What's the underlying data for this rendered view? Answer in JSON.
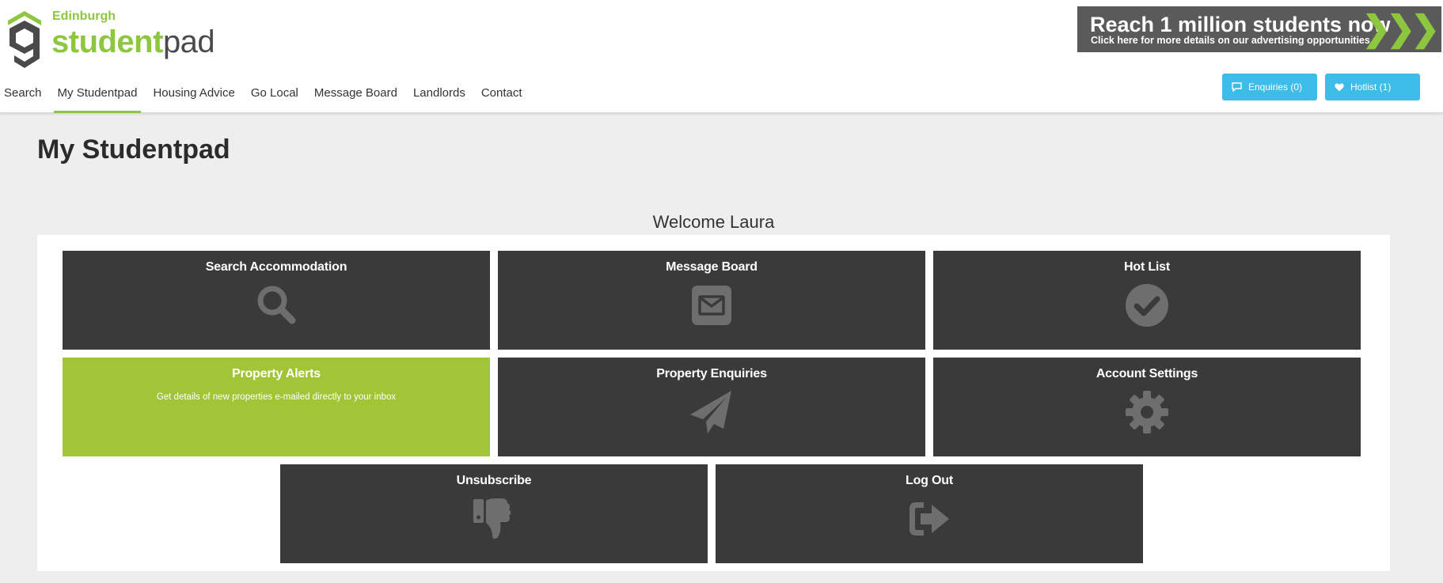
{
  "logo": {
    "city": "Edinburgh",
    "brand_part1": "student",
    "brand_part2": "pad"
  },
  "ad": {
    "headline": "Reach 1 million students now",
    "subline": "Click here for more details on our advertising opportunities",
    "arrows": "❯❯❯"
  },
  "nav": {
    "items": [
      {
        "label": "Search"
      },
      {
        "label": "My Studentpad"
      },
      {
        "label": "Housing Advice"
      },
      {
        "label": "Go Local"
      },
      {
        "label": "Message Board"
      },
      {
        "label": "Landlords"
      },
      {
        "label": "Contact"
      }
    ],
    "active": "My Studentpad"
  },
  "header_buttons": {
    "enquiries": "Enquiries (0)",
    "hotlist": "Hotlist (1)"
  },
  "colors": {
    "brand_green": "#8dc63f",
    "tile_dark": "#3a3a3a",
    "tile_green": "#a2c437",
    "button_blue": "#3dbce7",
    "icon_grey": "#6e6e6e"
  },
  "main": {
    "title": "My Studentpad",
    "welcome": "Welcome Laura",
    "tiles": [
      {
        "title": "Search Accommodation",
        "icon": "search-icon"
      },
      {
        "title": "Message Board",
        "icon": "envelope-icon"
      },
      {
        "title": "Hot List",
        "icon": "check-circle-icon"
      },
      {
        "title": "Property Alerts",
        "description": "Get details of new properties e-mailed directly to your inbox"
      },
      {
        "title": "Property Enquiries",
        "icon": "paper-plane-icon"
      },
      {
        "title": "Account Settings",
        "icon": "gear-icon"
      },
      {
        "title": "Unsubscribe",
        "icon": "thumbs-down-icon"
      },
      {
        "title": "Log Out",
        "icon": "sign-out-icon"
      }
    ]
  }
}
